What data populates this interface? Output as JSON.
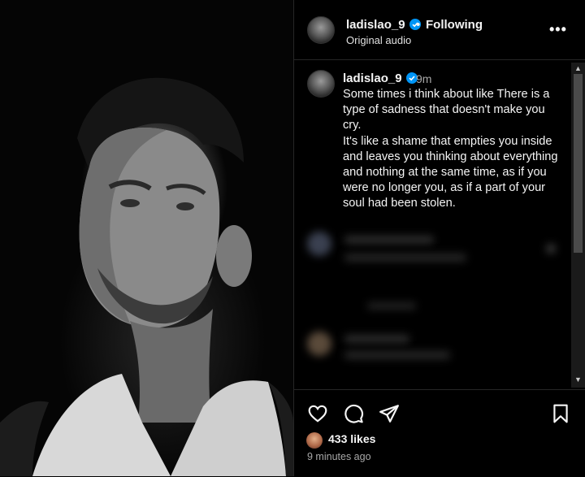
{
  "post": {
    "username": "ladislao_9",
    "following_label": "Following",
    "audio_label": "Original audio",
    "more_label": "•••"
  },
  "caption": {
    "username": "ladislao_9",
    "time": "9m",
    "text": "Some times i think about like There is a type of sadness that doesn't make you cry.\nIt's like a shame that empties you inside and leaves you thinking about everything and nothing at the same time, as if you were no longer you, as if a part of your soul had been stolen."
  },
  "engagement": {
    "likes": "433 likes",
    "posted_ago": "9 minutes ago"
  },
  "icons": {
    "like": "heart-icon",
    "comment": "comment-icon",
    "share": "share-icon",
    "save": "bookmark-icon",
    "verified": "verified-badge-icon"
  },
  "colors": {
    "background": "#000000",
    "verified": "#0095f6",
    "secondary_text": "#a8a8a8"
  }
}
